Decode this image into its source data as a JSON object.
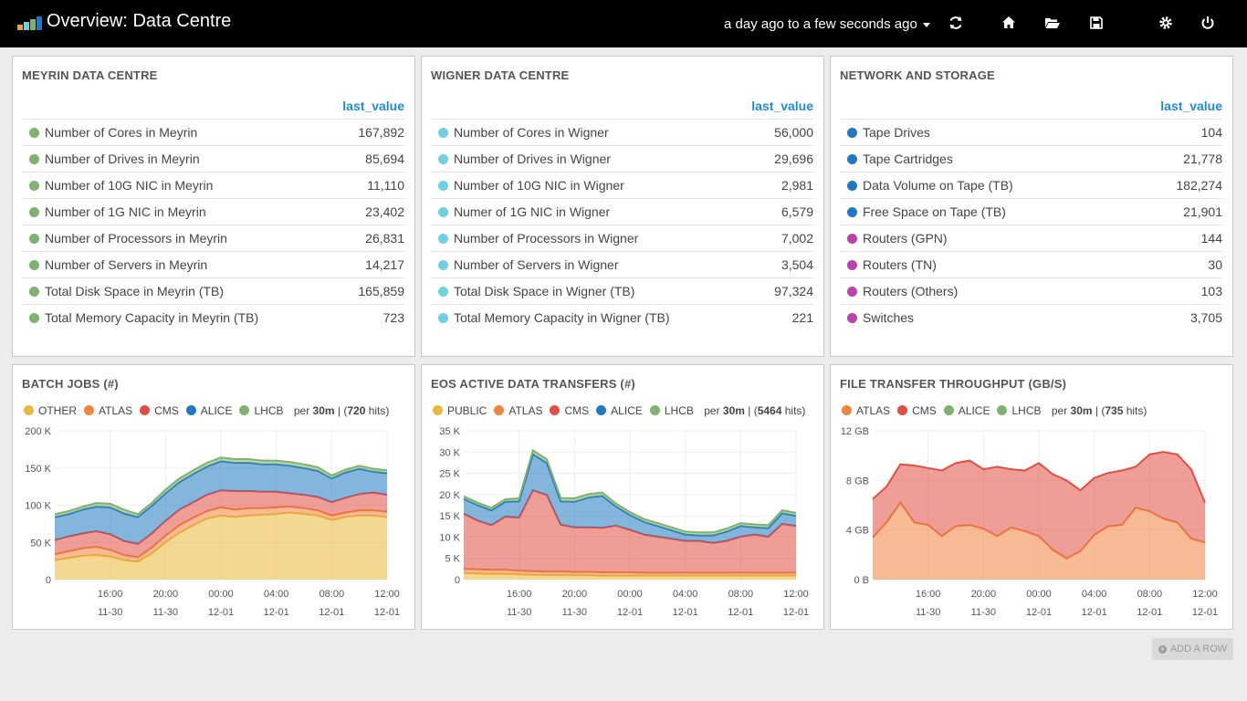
{
  "topbar": {
    "title": "Overview: Data Centre",
    "timerange": "a day ago to a few seconds ago",
    "icons": [
      "refresh-icon",
      "home-icon",
      "folder-open-icon",
      "save-icon",
      "gear-icon",
      "power-icon"
    ]
  },
  "column_header": "last_value",
  "colors": {
    "meyrin": "#7eb26d",
    "wigner": "#6ed0e0",
    "network_blue": "#1f78c1",
    "network_purple": "#ba43a9",
    "other": "#eab839",
    "atlas": "#ef843c",
    "cms": "#e24d42",
    "alice": "#1f78c1",
    "lhcb": "#7eb26d"
  },
  "panels": {
    "meyrin": {
      "title": "MEYRIN DATA CENTRE",
      "rows": [
        {
          "label": "Number of Cores in Meyrin",
          "value": "167,892"
        },
        {
          "label": "Number of Drives in Meyrin",
          "value": "85,694"
        },
        {
          "label": "Number of 10G NIC in Meyrin",
          "value": "11,110"
        },
        {
          "label": "Number of 1G NIC in Meyrin",
          "value": "23,402"
        },
        {
          "label": "Number of Processors in Meyrin",
          "value": "26,831"
        },
        {
          "label": "Number of Servers in Meyrin",
          "value": "14,217"
        },
        {
          "label": "Total Disk Space in Meyrin (TB)",
          "value": "165,859"
        },
        {
          "label": "Total Memory Capacity in Meyrin (TB)",
          "value": "723"
        }
      ]
    },
    "wigner": {
      "title": "WIGNER DATA CENTRE",
      "rows": [
        {
          "label": "Number of Cores in Wigner",
          "value": "56,000"
        },
        {
          "label": "Number of Drives in Wigner",
          "value": "29,696"
        },
        {
          "label": "Number of 10G NIC in Wigner",
          "value": "2,981"
        },
        {
          "label": "Numer of 1G NIC in Wigner",
          "value": "6,579"
        },
        {
          "label": "Number of Processors in Wigner",
          "value": "7,002"
        },
        {
          "label": "Number of Servers in Wigner",
          "value": "3,504"
        },
        {
          "label": "Total Disk Space in Wigner (TB)",
          "value": "97,324"
        },
        {
          "label": "Total Memory Capacity in Wigner (TB)",
          "value": "221"
        }
      ]
    },
    "network": {
      "title": "NETWORK AND STORAGE",
      "rows": [
        {
          "label": "Tape Drives",
          "value": "104",
          "color": "#1f78c1"
        },
        {
          "label": "Tape Cartridges",
          "value": "21,778",
          "color": "#1f78c1"
        },
        {
          "label": "Data Volume on Tape (TB)",
          "value": "182,274",
          "color": "#1f78c1"
        },
        {
          "label": "Free Space on Tape (TB)",
          "value": "21,901",
          "color": "#1f78c1"
        },
        {
          "label": "Routers (GPN)",
          "value": "144",
          "color": "#ba43a9"
        },
        {
          "label": "Routers (TN)",
          "value": "30",
          "color": "#ba43a9"
        },
        {
          "label": "Routers (Others)",
          "value": "103",
          "color": "#ba43a9"
        },
        {
          "label": "Switches",
          "value": "3,705",
          "color": "#ba43a9"
        }
      ]
    }
  },
  "charts": {
    "batch": {
      "title": "BATCH JOBS (#)",
      "legend_per": "per",
      "legend_interval": "30m",
      "legend_sep": " | (",
      "legend_hits": "720",
      "legend_hits_suffix": " hits)"
    },
    "eos": {
      "title": "EOS ACTIVE DATA TRANSFERS (#)",
      "legend_per": "per",
      "legend_interval": "30m",
      "legend_sep": " | (",
      "legend_hits": "5464",
      "legend_hits_suffix": " hits)"
    },
    "fts": {
      "title": "FILE TRANSFER THROUGHPUT (GB/S)",
      "legend_per": "per",
      "legend_interval": "30m",
      "legend_sep": " | (",
      "legend_hits": "735",
      "legend_hits_suffix": " hits)"
    }
  },
  "chart_data": [
    {
      "type": "area",
      "title": "BATCH JOBS (#)",
      "stacked": true,
      "x": [
        "12:00",
        "13:00",
        "14:00",
        "15:00",
        "16:00",
        "17:00",
        "18:00",
        "19:00",
        "20:00",
        "21:00",
        "22:00",
        "23:00",
        "00:00",
        "01:00",
        "02:00",
        "03:00",
        "04:00",
        "05:00",
        "06:00",
        "07:00",
        "08:00",
        "09:00",
        "10:00",
        "11:00",
        "12:00"
      ],
      "x_ticks": [
        {
          "time": "16:00",
          "date": "11-30"
        },
        {
          "time": "20:00",
          "date": "11-30"
        },
        {
          "time": "00:00",
          "date": "12-01"
        },
        {
          "time": "04:00",
          "date": "12-01"
        },
        {
          "time": "08:00",
          "date": "12-01"
        },
        {
          "time": "12:00",
          "date": "12-01"
        }
      ],
      "y_ticks": [
        "0",
        "50 K",
        "100 K",
        "150 K",
        "200 K"
      ],
      "ylim": [
        0,
        200000
      ],
      "series": [
        {
          "name": "OTHER",
          "color": "#eab839",
          "values": [
            26000,
            29000,
            32000,
            33000,
            31000,
            26000,
            24000,
            35000,
            50000,
            63000,
            73000,
            82000,
            86000,
            84000,
            86000,
            87000,
            88000,
            90000,
            88000,
            86000,
            80000,
            84000,
            86000,
            86000,
            84000
          ]
        },
        {
          "name": "ATLAS",
          "color": "#ef843c",
          "values": [
            8000,
            9000,
            10000,
            11000,
            9000,
            7000,
            6000,
            8000,
            9000,
            10000,
            10000,
            10000,
            11000,
            10000,
            10000,
            9000,
            9000,
            8000,
            8000,
            7000,
            6000,
            6000,
            7000,
            7000,
            7000
          ]
        },
        {
          "name": "CMS",
          "color": "#e24d42",
          "values": [
            19000,
            20000,
            20000,
            21000,
            21000,
            19000,
            18000,
            19000,
            20000,
            21000,
            21000,
            22000,
            23000,
            25000,
            23000,
            22000,
            21000,
            18000,
            18000,
            18000,
            18000,
            20000,
            22000,
            24000,
            23000
          ]
        },
        {
          "name": "ALICE",
          "color": "#1f78c1",
          "values": [
            31000,
            30000,
            32000,
            33000,
            36000,
            37000,
            36000,
            37000,
            37000,
            37000,
            38000,
            38000,
            39000,
            38000,
            38000,
            37000,
            37000,
            37000,
            36000,
            35000,
            32000,
            34000,
            34000,
            28000,
            29000
          ]
        },
        {
          "name": "LHCB",
          "color": "#7eb26d",
          "values": [
            4000,
            4000,
            4000,
            5000,
            5000,
            5000,
            4000,
            4000,
            5000,
            5000,
            5000,
            5000,
            5000,
            5000,
            5000,
            5000,
            5000,
            5000,
            5000,
            5000,
            4000,
            4000,
            4000,
            4000,
            4000
          ]
        }
      ]
    },
    {
      "type": "area",
      "title": "EOS ACTIVE DATA TRANSFERS (#)",
      "stacked": true,
      "x": [
        "12:00",
        "13:00",
        "14:00",
        "15:00",
        "16:00",
        "17:00",
        "18:00",
        "19:00",
        "20:00",
        "21:00",
        "22:00",
        "23:00",
        "00:00",
        "01:00",
        "02:00",
        "03:00",
        "04:00",
        "05:00",
        "06:00",
        "07:00",
        "08:00",
        "09:00",
        "10:00",
        "11:00",
        "12:00"
      ],
      "x_ticks": [
        {
          "time": "16:00",
          "date": "11-30"
        },
        {
          "time": "20:00",
          "date": "11-30"
        },
        {
          "time": "00:00",
          "date": "12-01"
        },
        {
          "time": "04:00",
          "date": "12-01"
        },
        {
          "time": "08:00",
          "date": "12-01"
        },
        {
          "time": "12:00",
          "date": "12-01"
        }
      ],
      "y_ticks": [
        "0",
        "5 K",
        "10 K",
        "15 K",
        "20 K",
        "25 K",
        "30 K",
        "35 K"
      ],
      "ylim": [
        0,
        35000
      ],
      "series": [
        {
          "name": "PUBLIC",
          "color": "#eab839",
          "values": [
            1500,
            1400,
            1300,
            1300,
            1200,
            1100,
            1000,
            1000,
            1000,
            1000,
            900,
            900,
            900,
            900,
            900,
            900,
            900,
            900,
            900,
            900,
            900,
            900,
            900,
            900,
            900
          ]
        },
        {
          "name": "ATLAS",
          "color": "#ef843c",
          "values": [
            1000,
            1000,
            1000,
            1000,
            900,
            900,
            900,
            900,
            800,
            800,
            800,
            800,
            800,
            700,
            700,
            700,
            700,
            700,
            700,
            700,
            700,
            700,
            700,
            700,
            700
          ]
        },
        {
          "name": "CMS",
          "color": "#e24d42",
          "values": [
            13000,
            11500,
            10500,
            12500,
            12500,
            19000,
            18000,
            11000,
            10500,
            10500,
            10500,
            11000,
            10000,
            9000,
            8500,
            8000,
            7500,
            7500,
            7000,
            7500,
            8500,
            9000,
            8500,
            11500,
            11000
          ]
        },
        {
          "name": "ALICE",
          "color": "#1f78c1",
          "values": [
            3500,
            3600,
            3500,
            3500,
            3800,
            8500,
            7500,
            5500,
            6000,
            7000,
            7500,
            4500,
            3500,
            3000,
            2500,
            2000,
            1500,
            1300,
            1800,
            2200,
            2500,
            1700,
            2000,
            2500,
            2400
          ]
        },
        {
          "name": "LHCB",
          "color": "#7eb26d",
          "values": [
            600,
            600,
            600,
            600,
            700,
            900,
            900,
            800,
            800,
            800,
            800,
            700,
            700,
            700,
            700,
            700,
            700,
            700,
            700,
            700,
            700,
            700,
            700,
            700,
            700
          ]
        }
      ]
    },
    {
      "type": "area",
      "title": "FILE TRANSFER THROUGHPUT (GB/S)",
      "stacked": true,
      "x": [
        "12:00",
        "13:00",
        "14:00",
        "15:00",
        "16:00",
        "17:00",
        "18:00",
        "19:00",
        "20:00",
        "21:00",
        "22:00",
        "23:00",
        "00:00",
        "01:00",
        "02:00",
        "03:00",
        "04:00",
        "05:00",
        "06:00",
        "07:00",
        "08:00",
        "09:00",
        "10:00",
        "11:00",
        "12:00"
      ],
      "x_ticks": [
        {
          "time": "16:00",
          "date": "11-30"
        },
        {
          "time": "20:00",
          "date": "11-30"
        },
        {
          "time": "00:00",
          "date": "12-01"
        },
        {
          "time": "04:00",
          "date": "12-01"
        },
        {
          "time": "08:00",
          "date": "12-01"
        },
        {
          "time": "12:00",
          "date": "12-01"
        }
      ],
      "y_ticks": [
        "0 B",
        "4 GB",
        "8 GB",
        "12 GB"
      ],
      "ylim": [
        0,
        12
      ],
      "series": [
        {
          "name": "ATLAS",
          "color": "#ef843c",
          "values": [
            3.4,
            4.6,
            6.2,
            4.6,
            4.4,
            3.5,
            4.3,
            4.4,
            4.1,
            3.5,
            4.2,
            3.9,
            3.5,
            2.4,
            1.7,
            2.3,
            3.6,
            4.3,
            4.4,
            5.8,
            5.5,
            4.9,
            4.6,
            3.3,
            3.0
          ]
        },
        {
          "name": "CMS",
          "color": "#e24d42",
          "values": [
            3.1,
            2.9,
            3.1,
            4.6,
            4.6,
            5.3,
            5.1,
            5.2,
            4.8,
            5.6,
            4.7,
            4.9,
            5.9,
            6.1,
            6.3,
            4.9,
            4.6,
            4.3,
            4.4,
            3.3,
            4.6,
            5.4,
            5.5,
            5.6,
            3.2
          ]
        },
        {
          "name": "ALICE",
          "color": "#7eb26d",
          "values": [
            0,
            0,
            0,
            0,
            0,
            0,
            0,
            0,
            0,
            0,
            0,
            0,
            0,
            0,
            0,
            0,
            0,
            0,
            0,
            0,
            0,
            0,
            0,
            0,
            0
          ]
        },
        {
          "name": "LHCB",
          "color": "#7eb26d",
          "values": [
            0,
            0,
            0,
            0,
            0,
            0,
            0,
            0,
            0,
            0,
            0,
            0,
            0,
            0,
            0,
            0,
            0,
            0,
            0,
            0,
            0,
            0,
            0,
            0,
            0
          ]
        }
      ]
    }
  ],
  "add_row": "ADD A ROW"
}
